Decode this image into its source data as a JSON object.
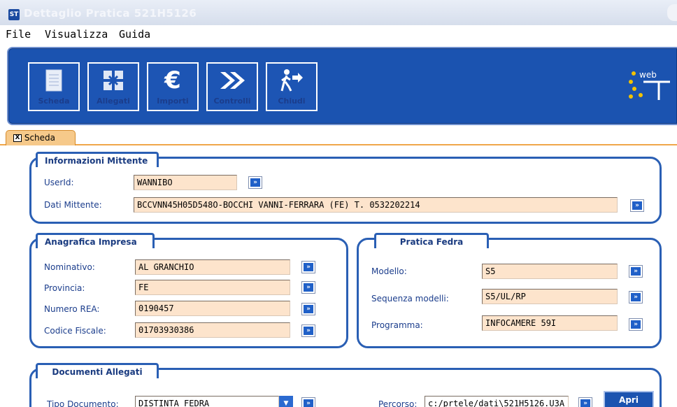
{
  "window": {
    "title": "Dettaglio Pratica 521H5126"
  },
  "menu": {
    "items": [
      "File",
      "Visualizza",
      "Guida"
    ]
  },
  "toolbar": {
    "buttons": [
      "Scheda",
      "Allegati",
      "Importi",
      "Controlli",
      "Chiudi"
    ],
    "logo_text": "web"
  },
  "tab": {
    "close_glyph": "X",
    "label": "Scheda"
  },
  "mittente": {
    "title": "Informazioni Mittente",
    "userid_label": "UserId:",
    "userid_value": "WANNIBO",
    "dati_label": "Dati Mittente:",
    "dati_value": "BCCVNN45H05D548O-BOCCHI VANNI-FERRARA (FE) T. 0532202214"
  },
  "impresa": {
    "title": "Anagrafica Impresa",
    "rows": [
      {
        "label": "Nominativo:",
        "value": "AL GRANCHIO"
      },
      {
        "label": "Provincia:",
        "value": "FE"
      },
      {
        "label": "Numero REA:",
        "value": "0190457"
      },
      {
        "label": "Codice Fiscale:",
        "value": "01703930386"
      }
    ]
  },
  "fedra": {
    "title": "Pratica Fedra",
    "rows": [
      {
        "label": "Modello:",
        "value": "S5"
      },
      {
        "label": "Sequenza modelli:",
        "value": "S5/UL/RP"
      },
      {
        "label": "Programma:",
        "value": "INFOCAMERE 59I"
      }
    ]
  },
  "allegati": {
    "title": "Documenti Allegati",
    "tipo_label": "Tipo Documento:",
    "tipo_value": "DISTINTA FEDRA",
    "percorso_label": "Percorso:",
    "percorso_value": "c:/prtele/dati\\521H5126.U3A",
    "apri_label": "Apri"
  },
  "go_glyph": "»",
  "colors": {
    "accent": "#1b53b0",
    "field_bg": "#fde4cc",
    "tab": "#f6c98a",
    "panel_border": "#2a5fb4"
  }
}
